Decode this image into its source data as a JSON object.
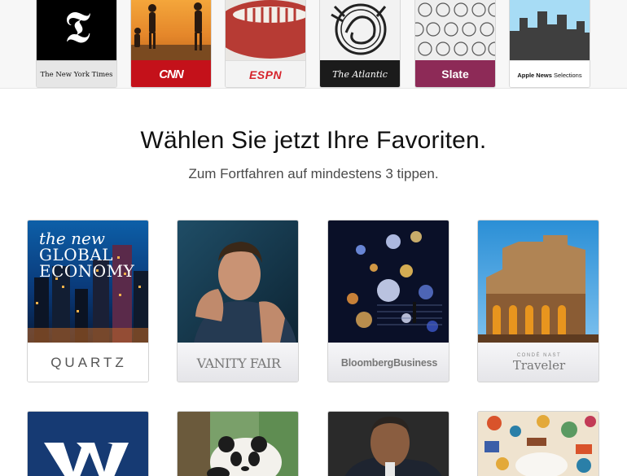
{
  "channels": [
    {
      "name": "The New York Times",
      "logo": "𝕿"
    },
    {
      "name": "CNN"
    },
    {
      "name": "ESPN"
    },
    {
      "name": "The Atlantic"
    },
    {
      "name": "Slate"
    },
    {
      "name": "Apple News",
      "name_suffix": "Selections"
    }
  ],
  "heading": {
    "title": "Wählen Sie jetzt Ihre Favoriten.",
    "subtitle": "Zum Fortfahren auf mindestens 3 tippen."
  },
  "publications": [
    {
      "name": "QUARTZ",
      "cover_text": [
        "the new",
        "GLOBAL",
        "ECONOMY"
      ]
    },
    {
      "name": "VANITY FAIR"
    },
    {
      "name": "BloombergBusiness"
    },
    {
      "name": "Traveler",
      "kicker": "CONDÉ NAST"
    },
    {
      "name": "Washington Post"
    },
    {
      "name": "Panda story"
    },
    {
      "name": "Obama story"
    },
    {
      "name": "Illustration story"
    }
  ],
  "colors": {
    "cnn_red": "#c4111a",
    "espn_red": "#d6222a",
    "slate_purple": "#8d2a57",
    "atlantic_black": "#1b1b1b",
    "wapo_navy": "#163a73"
  }
}
